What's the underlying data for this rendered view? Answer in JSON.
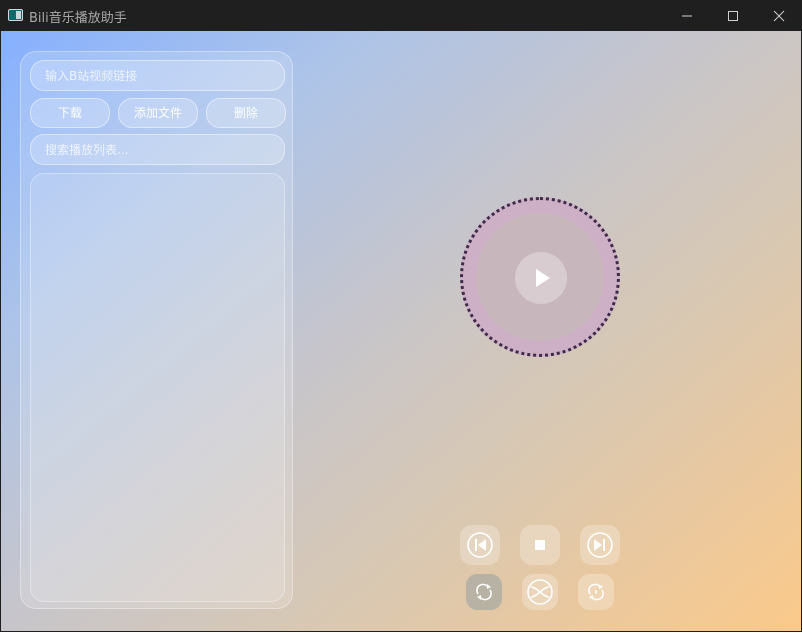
{
  "window": {
    "title": "Bili音乐播放助手",
    "controls": [
      "minimize-icon",
      "maximize-icon",
      "close-icon"
    ]
  },
  "sidebar": {
    "url_input": {
      "placeholder": "输入B站视频链接",
      "value": ""
    },
    "buttons": {
      "download": "下载",
      "add_file": "添加文件",
      "delete": "删除"
    },
    "search_input": {
      "placeholder": "搜索播放列表...",
      "value": ""
    },
    "playlist": []
  },
  "player": {
    "center_button_icon": "play-icon",
    "controls": [
      "previous-icon",
      "stop-icon",
      "next-icon"
    ],
    "modes": [
      "repeat-all-icon",
      "shuffle-icon",
      "repeat-one-icon"
    ],
    "active_mode": "repeat-all-icon"
  },
  "colors": {
    "gradient_start": "#86b0ff",
    "gradient_end": "#fbc98a",
    "disc_ring": "#cdb0c6",
    "disc_dots": "#3e2a4a"
  }
}
